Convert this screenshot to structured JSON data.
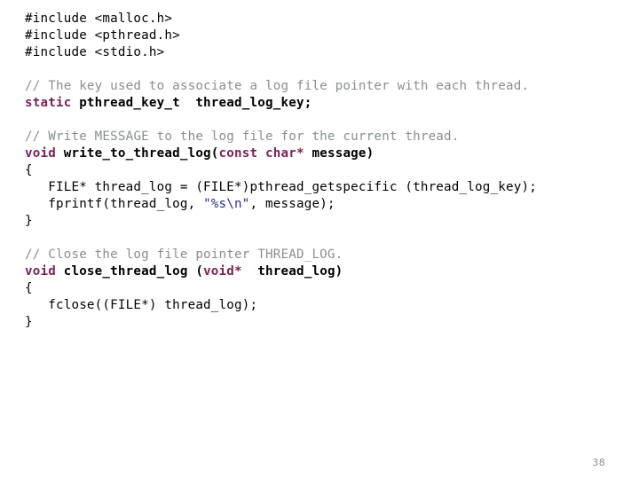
{
  "slide": {
    "page_number": "38",
    "background_color": "#ffffff",
    "colors": {
      "comment": "#87908f",
      "keyword": "#7c2255",
      "declaration": "#000000",
      "string": "#2b2b8f",
      "plain": "#000000",
      "page_number": "#8c8c8c"
    }
  },
  "code": {
    "language": "c",
    "lines": [
      {
        "id": "line-1",
        "tokens": [
          {
            "text": "#include <malloc.h>",
            "style": "plain"
          }
        ]
      },
      {
        "id": "line-2",
        "tokens": [
          {
            "text": "#include <pthread.h>",
            "style": "plain"
          }
        ]
      },
      {
        "id": "line-3",
        "tokens": [
          {
            "text": "#include <stdio.h>",
            "style": "plain"
          }
        ]
      },
      {
        "id": "line-4",
        "tokens": []
      },
      {
        "id": "line-5",
        "tokens": [
          {
            "text": "// The key used to associate a log file pointer with each thread.",
            "style": "comment"
          }
        ]
      },
      {
        "id": "line-6",
        "tokens": [
          {
            "text": "static",
            "style": "keyword"
          },
          {
            "text": " pthread_key_t  thread_log_key;",
            "style": "declaration"
          }
        ]
      },
      {
        "id": "line-7",
        "tokens": []
      },
      {
        "id": "line-8",
        "tokens": [
          {
            "text": "// Write MESSAGE to the log file for the current thread.",
            "style": "comment"
          }
        ]
      },
      {
        "id": "line-9",
        "tokens": [
          {
            "text": "void",
            "style": "keyword"
          },
          {
            "text": " write_to_thread_log(",
            "style": "declaration"
          },
          {
            "text": "const",
            "style": "keyword"
          },
          {
            "text": " ",
            "style": "declaration"
          },
          {
            "text": "char*",
            "style": "keyword"
          },
          {
            "text": " message)",
            "style": "declaration"
          }
        ]
      },
      {
        "id": "line-10",
        "tokens": [
          {
            "text": "{",
            "style": "plain"
          }
        ]
      },
      {
        "id": "line-11",
        "tokens": [
          {
            "text": "   FILE* thread_log = (FILE*)pthread_getspecific (thread_log_key);",
            "style": "plain"
          }
        ]
      },
      {
        "id": "line-12",
        "tokens": [
          {
            "text": "   fprintf(thread_log, ",
            "style": "plain"
          },
          {
            "text": "\"%s\\n\"",
            "style": "string"
          },
          {
            "text": ", message);",
            "style": "plain"
          }
        ]
      },
      {
        "id": "line-13",
        "tokens": [
          {
            "text": "}",
            "style": "plain"
          }
        ]
      },
      {
        "id": "line-14",
        "tokens": []
      },
      {
        "id": "line-15",
        "tokens": [
          {
            "text": "// Close the log file pointer THREAD_LOG.",
            "style": "comment"
          }
        ]
      },
      {
        "id": "line-16",
        "tokens": [
          {
            "text": "void",
            "style": "keyword"
          },
          {
            "text": " close_thread_log (",
            "style": "declaration"
          },
          {
            "text": "void*",
            "style": "keyword"
          },
          {
            "text": "  thread_log)",
            "style": "declaration"
          }
        ]
      },
      {
        "id": "line-17",
        "tokens": [
          {
            "text": "{",
            "style": "plain"
          }
        ]
      },
      {
        "id": "line-18",
        "tokens": [
          {
            "text": "   fclose((FILE*) thread_log);",
            "style": "plain"
          }
        ]
      },
      {
        "id": "line-19",
        "tokens": [
          {
            "text": "}",
            "style": "plain"
          }
        ]
      }
    ]
  }
}
